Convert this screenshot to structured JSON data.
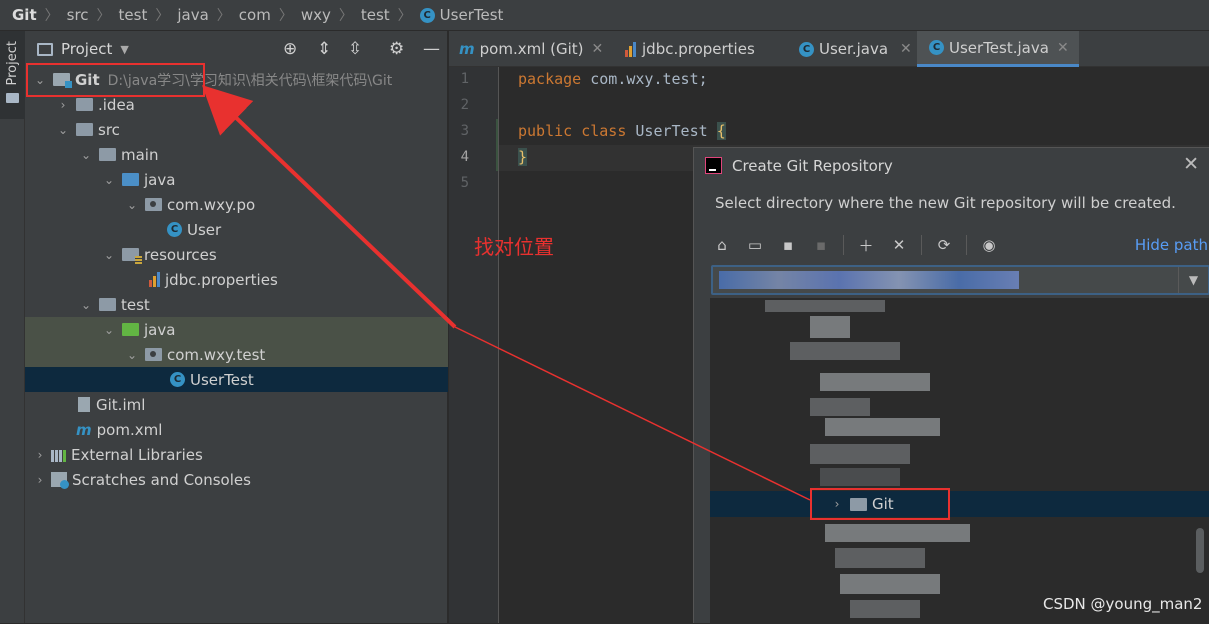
{
  "breadcrumb": {
    "items": [
      "Git",
      "src",
      "test",
      "java",
      "com",
      "wxy",
      "test",
      "UserTest"
    ]
  },
  "stripe": {
    "tab_label": "Project"
  },
  "project_panel": {
    "title": "Project",
    "tree": [
      {
        "label": "Git",
        "hint": "D:\\java学习\\学习知识\\相关代码\\框架代码\\Git",
        "kind": "module"
      },
      {
        "label": ".idea",
        "kind": "folder"
      },
      {
        "label": "src",
        "kind": "folder"
      },
      {
        "label": "main",
        "kind": "folder"
      },
      {
        "label": "java",
        "kind": "source-folder"
      },
      {
        "label": "com.wxy.po",
        "kind": "package"
      },
      {
        "label": "User",
        "kind": "class"
      },
      {
        "label": "resources",
        "kind": "resources-folder"
      },
      {
        "label": "jdbc.properties",
        "kind": "properties"
      },
      {
        "label": "test",
        "kind": "folder"
      },
      {
        "label": "java",
        "kind": "test-folder"
      },
      {
        "label": "com.wxy.test",
        "kind": "package"
      },
      {
        "label": "UserTest",
        "kind": "class"
      },
      {
        "label": "Git.iml",
        "kind": "iml"
      },
      {
        "label": "pom.xml",
        "kind": "maven"
      },
      {
        "label": "External Libraries",
        "kind": "libraries"
      },
      {
        "label": "Scratches and Consoles",
        "kind": "scratches"
      }
    ]
  },
  "editor": {
    "tabs": [
      {
        "label": "pom.xml (Git)",
        "icon": "maven-icon"
      },
      {
        "label": "jdbc.properties",
        "icon": "properties-icon"
      },
      {
        "label": "User.java",
        "icon": "class-icon"
      },
      {
        "label": "UserTest.java",
        "icon": "class-icon",
        "active": true
      }
    ],
    "line_numbers": [
      "1",
      "2",
      "3",
      "4",
      "5"
    ],
    "code": {
      "line1_kw": "package",
      "line1_rest": " com.wxy.test;",
      "line3_kw1": "public",
      "line3_kw2": "class",
      "line3_name": " UserTest ",
      "line3_brace": "{",
      "line4_brace": "}"
    }
  },
  "dialog": {
    "title": "Create Git Repository",
    "description": "Select directory where the new Git repository will be created.",
    "hide_path": "Hide path",
    "selected_folder": "Git",
    "close_label": "✕"
  },
  "annotation": {
    "text": "找对位置",
    "color": "#e8312f"
  },
  "watermark": "CSDN @young_man2"
}
